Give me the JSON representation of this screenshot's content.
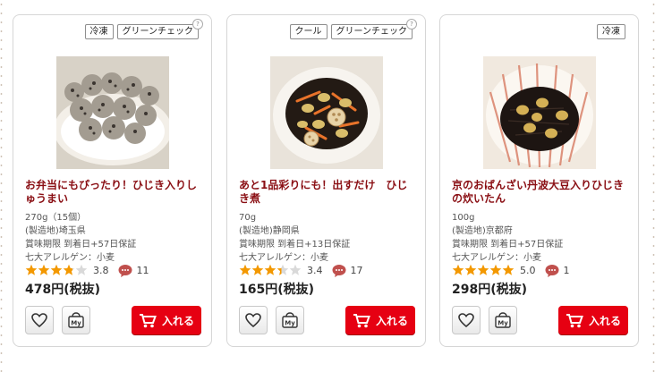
{
  "products": [
    {
      "tags": [
        "冷凍",
        "グリーンチェック"
      ],
      "title": "お弁当にもぴったり！ひじき入りしゅうまい",
      "amount": "270g（15個）",
      "origin": "(製造地)埼玉県",
      "expiry": "賞味期限 到着日+57日保証",
      "allergen": "七大アレルゲン：小麦",
      "rating": 3.8,
      "rating_text": "3.8",
      "reviews": "11",
      "price": "478円(税抜)",
      "cart_label": "入れる",
      "my_label": "My"
    },
    {
      "tags": [
        "クール",
        "グリーンチェック"
      ],
      "title": "あと1品彩りにも！出すだけ　ひじき煮",
      "amount": "70g",
      "origin": "(製造地)静岡県",
      "expiry": "賞味期限 到着日+13日保証",
      "allergen": "七大アレルゲン：小麦",
      "rating": 3.4,
      "rating_text": "3.4",
      "reviews": "17",
      "price": "165円(税抜)",
      "cart_label": "入れる",
      "my_label": "My"
    },
    {
      "tags": [
        "冷凍"
      ],
      "title": "京のおばんざい丹波大豆入りひじきの炊いたん",
      "amount": "100g",
      "origin": "(製造地)京都府",
      "expiry": "賞味期限 到着日+57日保証",
      "allergen": "七大アレルゲン：小麦",
      "rating": 5.0,
      "rating_text": "5.0",
      "reviews": "1",
      "price": "298円(税抜)",
      "cart_label": "入れる",
      "my_label": "My"
    }
  ],
  "help_mark": "?",
  "colors": {
    "title": "#8a0f14",
    "star": "#f39800",
    "star_empty": "#d9d9d9",
    "cart": "#e60012",
    "bubble": "#c0504d"
  },
  "icons": [
    "heart-icon",
    "my-bag-icon",
    "cart-icon",
    "star-icon",
    "comment-bubble-icon",
    "help-icon"
  ]
}
